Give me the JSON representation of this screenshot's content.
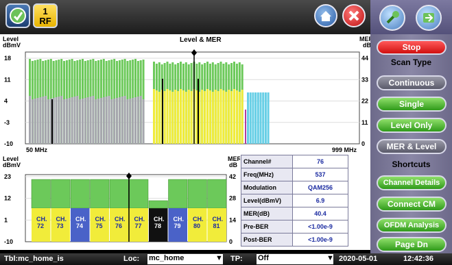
{
  "toolbar": {
    "rf_number": "1",
    "rf_label": "RF"
  },
  "chart1": {
    "title": "Level & MER",
    "left_axis": {
      "label_line1": "Level",
      "label_line2": "dBmV",
      "ticks": [
        "18",
        "11",
        "4",
        "-3",
        "-10"
      ]
    },
    "right_axis": {
      "label_line1": "MER",
      "label_line2": "dB",
      "ticks": [
        "44",
        "33",
        "22",
        "11",
        "0"
      ]
    },
    "x_start": "50 MHz",
    "x_end": "999 MHz"
  },
  "chart2": {
    "left_axis": {
      "label_line1": "Level",
      "label_line2": "dBmV",
      "ticks": [
        "23",
        "12",
        "1",
        "-10"
      ]
    },
    "right_axis": {
      "label_line1": "MER",
      "label_line2": "dB",
      "ticks": [
        "42",
        "28",
        "14",
        "0"
      ]
    },
    "channels": [
      "CH.\n72",
      "CH.\n73",
      "CH.\n74",
      "CH.\n75",
      "CH.\n76",
      "CH.\n77",
      "CH.\n78",
      "CH.\n79",
      "CH.\n80",
      "CH.\n81"
    ],
    "channel_labels": [
      "CH. 72",
      "CH. 73",
      "CH. 74",
      "CH. 75",
      "CH. 76",
      "CH. 77",
      "CH. 78",
      "CH. 79",
      "CH. 80",
      "CH. 81"
    ]
  },
  "info": [
    {
      "key": "Channel#",
      "value": "76"
    },
    {
      "key": "Freq(MHz)",
      "value": "537"
    },
    {
      "key": "Modulation",
      "value": "QAM256"
    },
    {
      "key": "Level(dBmV)",
      "value": "6.9"
    },
    {
      "key": "MER(dB)",
      "value": "40.4"
    },
    {
      "key": "Pre-BER",
      "value": "<1.00e-9"
    },
    {
      "key": "Post-BER",
      "value": "<1.00e-9"
    }
  ],
  "side": {
    "stop": "Stop",
    "scan_type": "Scan Type",
    "continuous": "Continuous",
    "single": "Single",
    "level_only": "Level Only",
    "mer_level": "MER & Level",
    "shortcuts": "Shortcuts",
    "channel_details": "Channel Details",
    "connect_cm": "Connect CM",
    "ofdm_analysis": "OFDM Analysis",
    "page_dn": "Page Dn"
  },
  "status": {
    "tbl": "Tbl:mc_home_is",
    "loc_label": "Loc:",
    "loc_value": "mc_home",
    "tp_label": "TP:",
    "tp_value": "Off",
    "date": "2020-05-01",
    "time": "12:42:36"
  },
  "colors": {
    "level": "#6cc95a",
    "mer_gray": "#a6a6ae",
    "mer_yellow": "#f1ec3a",
    "mer_cyan": "#67cfe6",
    "blue_ch": "#4a62c8",
    "black_ch": "#111111"
  }
}
